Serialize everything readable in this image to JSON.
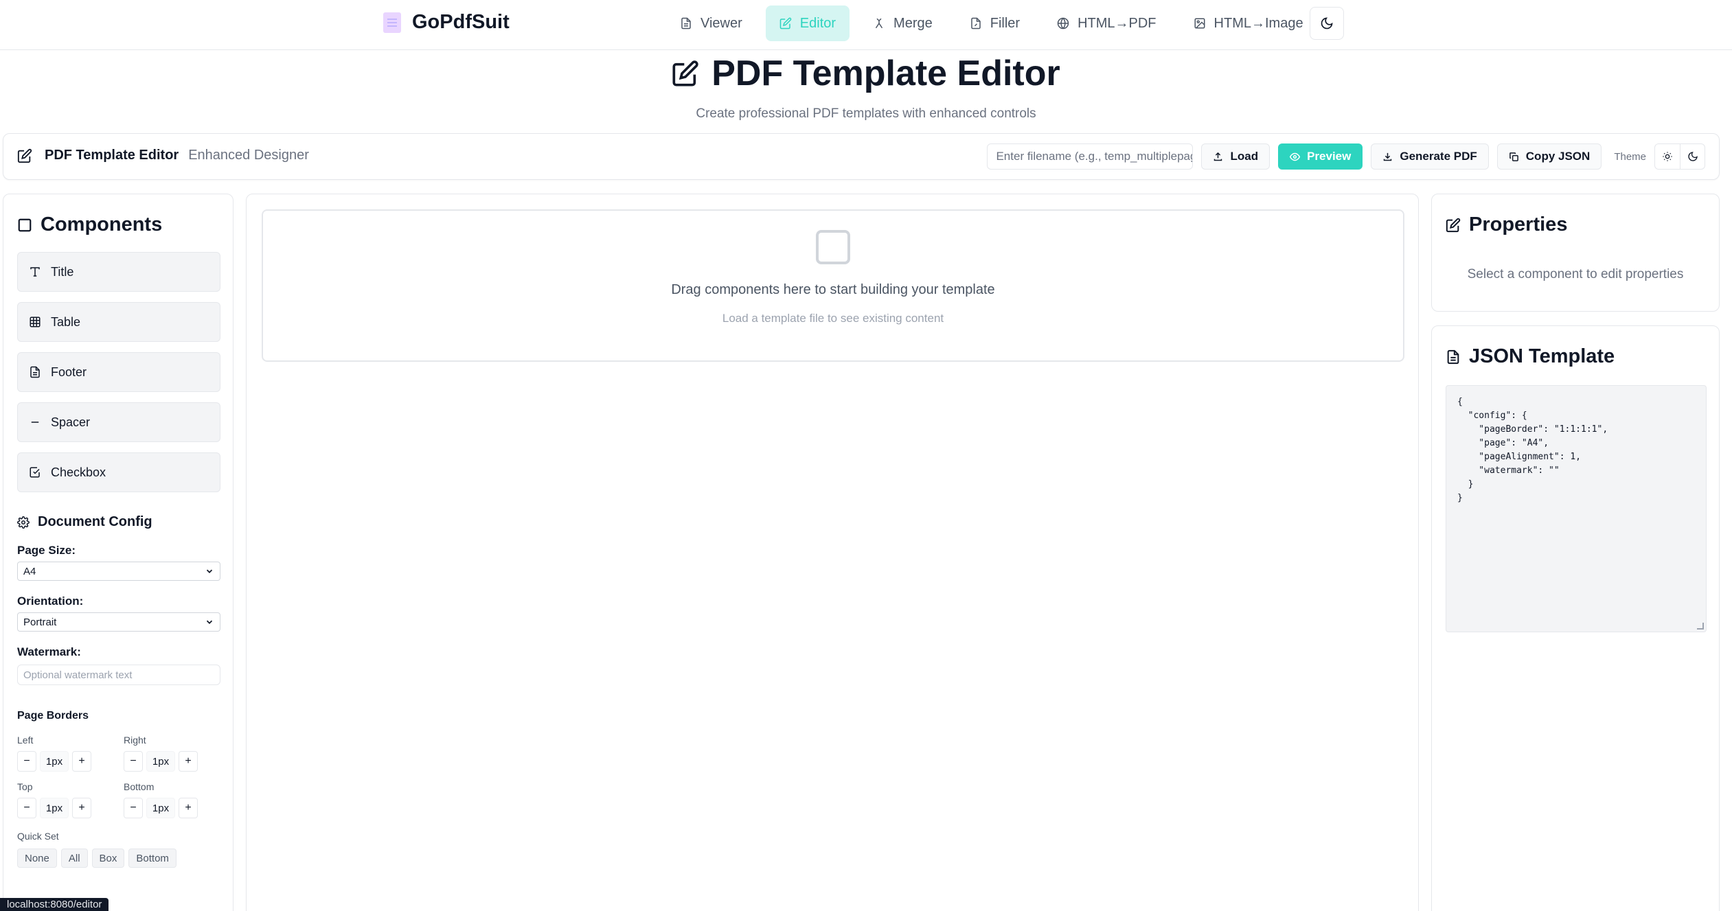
{
  "nav": {
    "brand": "GoPdfSuit",
    "links": [
      {
        "label": "Viewer",
        "icon": "file-icon"
      },
      {
        "label": "Editor",
        "icon": "edit-icon",
        "active": true
      },
      {
        "label": "Merge",
        "icon": "merge-icon"
      },
      {
        "label": "Filler",
        "icon": "file-edit-icon"
      },
      {
        "label": "HTML→PDF",
        "icon": "globe-icon"
      },
      {
        "label": "HTML→Image",
        "icon": "image-icon"
      }
    ],
    "accent": "#2dd4bf"
  },
  "header": {
    "title": "PDF Template Editor",
    "subtitle": "Create professional PDF templates with enhanced controls"
  },
  "toolbar": {
    "title": "PDF Template Editor",
    "subtitle": "Enhanced Designer",
    "filename_placeholder": "Enter filename (e.g., temp_multiplepage.json)",
    "load": "Load",
    "preview": "Preview",
    "generate": "Generate PDF",
    "copy_json": "Copy JSON",
    "theme_label": "Theme"
  },
  "components": {
    "heading": "Components",
    "items": [
      "Title",
      "Table",
      "Footer",
      "Spacer",
      "Checkbox"
    ]
  },
  "doc_config": {
    "heading": "Document Config",
    "page_size_label": "Page Size:",
    "page_size": "A4",
    "orientation_label": "Orientation:",
    "orientation": "Portrait",
    "watermark_label": "Watermark:",
    "watermark_placeholder": "Optional watermark text",
    "borders_heading": "Page Borders",
    "borders": {
      "left": {
        "label": "Left",
        "value": "1px"
      },
      "right": {
        "label": "Right",
        "value": "1px"
      },
      "top": {
        "label": "Top",
        "value": "1px"
      },
      "bottom": {
        "label": "Bottom",
        "value": "1px"
      }
    },
    "quick_set_label": "Quick Set",
    "quick_set": [
      "None",
      "All",
      "Box",
      "Bottom"
    ],
    "minus": "−",
    "plus": "+"
  },
  "canvas": {
    "drop_main": "Drag components here to start building your template",
    "drop_sub": "Load a template file to see existing content"
  },
  "properties": {
    "heading": "Properties",
    "empty": "Select a component to edit properties"
  },
  "json_template": {
    "heading": "JSON Template",
    "content": "{\n  \"config\": {\n    \"pageBorder\": \"1:1:1:1\",\n    \"page\": \"A4\",\n    \"pageAlignment\": 1,\n    \"watermark\": \"\"\n  }\n}"
  },
  "status_url": "localhost:8080/editor"
}
